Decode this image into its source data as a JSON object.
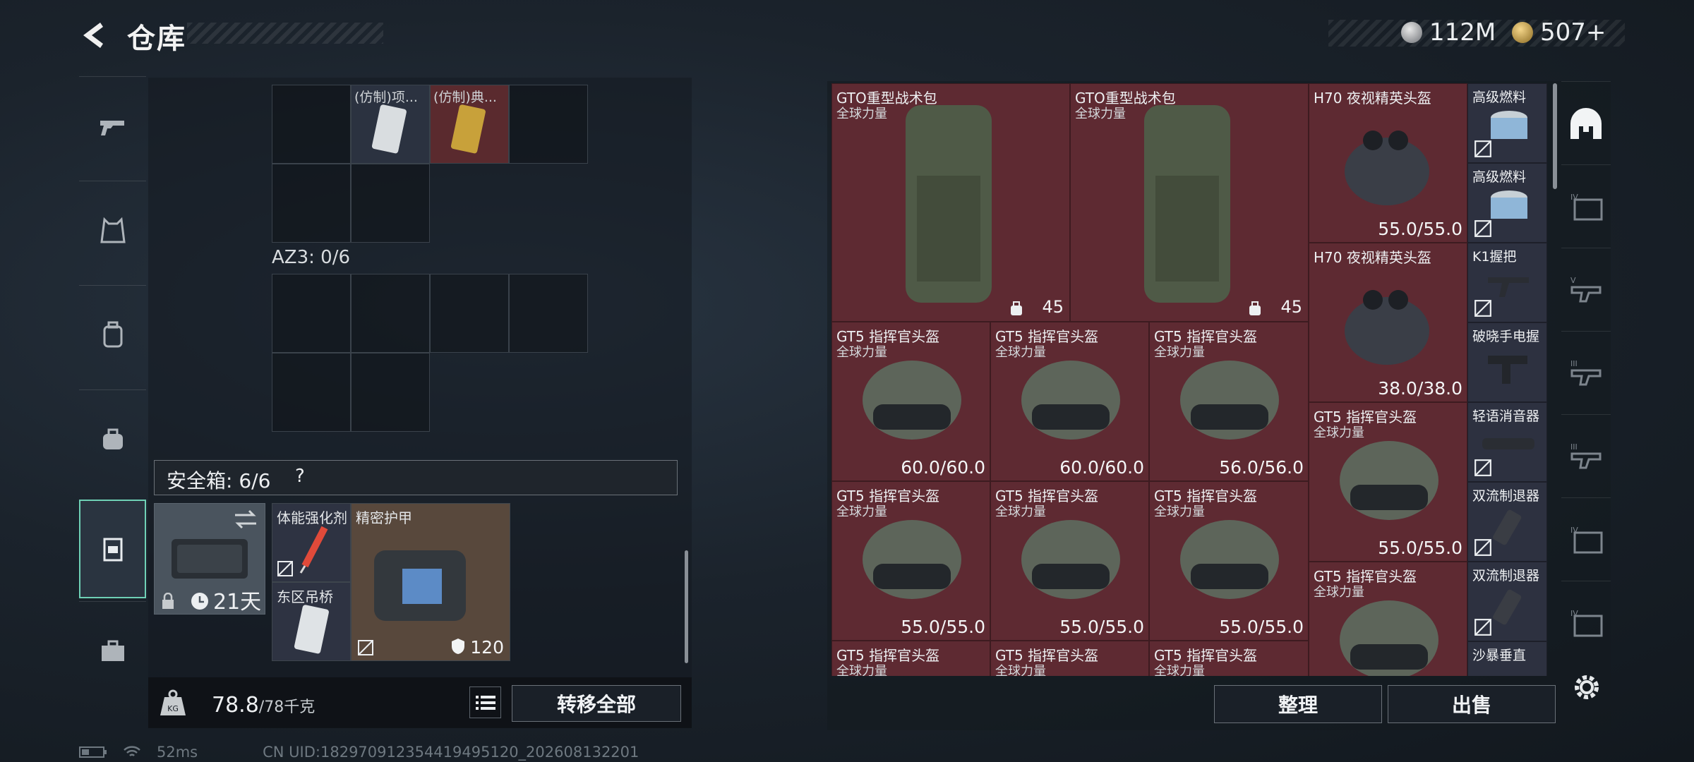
{
  "header": {
    "title": "仓库",
    "currency1": "112M",
    "currency2": "507+"
  },
  "left": {
    "top_items": [
      "(仿制)项...",
      "(仿制)典..."
    ],
    "az_label": "AZ3: 0/6",
    "safe_label": "安全箱: 6/6",
    "help": "?",
    "case_days": "21天",
    "slots": {
      "stim": "体能强化剂",
      "armor": "精密护甲",
      "bridge": "东区吊桥",
      "armor_value": "120"
    },
    "weight": "78.8",
    "weight_max": "/78千克",
    "transfer_label": "转移全部"
  },
  "stash": {
    "bags": [
      {
        "name": "GTO重型战术包",
        "sub": "全球力量",
        "cap": "45"
      },
      {
        "name": "GTO重型战术包",
        "sub": "全球力量",
        "cap": "45"
      }
    ],
    "h70": [
      {
        "name": "H70 夜视精英头盔",
        "dur": "55.0/55.0"
      },
      {
        "name": "H70 夜视精英头盔",
        "dur": "38.0/38.0"
      }
    ],
    "gt5_name": "GT5 指挥官头盔",
    "gt5_sub": "全球力量",
    "gt5_row1": [
      "60.0/60.0",
      "60.0/60.0",
      "56.0/56.0"
    ],
    "gt5_row2": [
      "55.0/55.0",
      "55.0/55.0",
      "55.0/55.0"
    ],
    "gt5_right": [
      "55.0/55.0",
      ""
    ],
    "side_items": [
      "高级燃料",
      "高级燃料",
      "K1握把",
      "破晓手电握",
      "轻语消音器",
      "双流制退器",
      "双流制退器",
      "沙暴垂直"
    ]
  },
  "buttons": {
    "sort": "整理",
    "sell": "出售"
  },
  "status": {
    "ping": "52ms",
    "uid": "CN UID:182970912354419495120_202608132201"
  }
}
